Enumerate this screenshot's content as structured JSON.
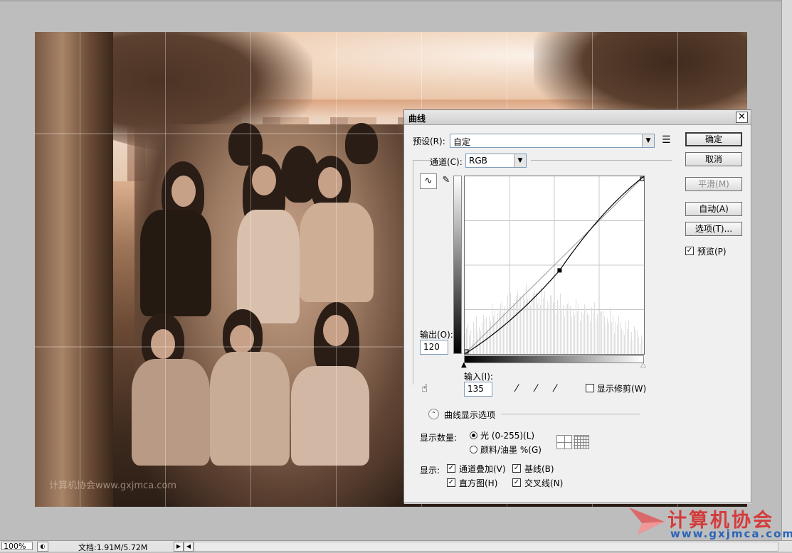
{
  "document": {
    "photo_watermark": "计算机协会www.gxjmca.com"
  },
  "curves_dialog": {
    "title": "曲线",
    "close_glyph": "✕",
    "preset_label": "预设(R):",
    "preset_value": "自定",
    "preset_menu_icon": "list-options-icon",
    "channel_label": "通道(C):",
    "channel_value": "RGB",
    "output_label": "输出(O):",
    "output_value": "120",
    "input_label": "输入(I):",
    "input_value": "135",
    "show_clipping_label": "显示修剪(W)",
    "show_clipping_checked": false,
    "buttons": {
      "ok": "确定",
      "cancel": "取消",
      "smooth": "平滑(M)",
      "auto": "自动(A)",
      "options": "选项(T)..."
    },
    "preview_label": "预览(P)",
    "preview_checked": true,
    "display_options_title": "曲线显示选项",
    "show_amount_label": "显示数量:",
    "light_option": "光 (0-255)(L)",
    "pigment_option": "颜料/油墨 %(G)",
    "light_selected": true,
    "show_label": "显示:",
    "channel_overlays": "通道叠加(V)",
    "baseline": "基线(B)",
    "histogram": "直方图(H)",
    "intersection_line": "交叉线(N)",
    "curve": {
      "point_input": 135,
      "point_output": 120
    }
  },
  "status_bar": {
    "zoom": "100%",
    "doc_size": "文档:1.91M/5.72M",
    "right_arrow": "▶",
    "left_arrow": "◀"
  },
  "watermark": {
    "name": "计算机协会",
    "url": "www.gxjmca.com"
  },
  "colors": {
    "brand_red": "#d43b3b",
    "brand_blue": "#2a64b8",
    "workspace_gray": "#bdbdbd"
  }
}
